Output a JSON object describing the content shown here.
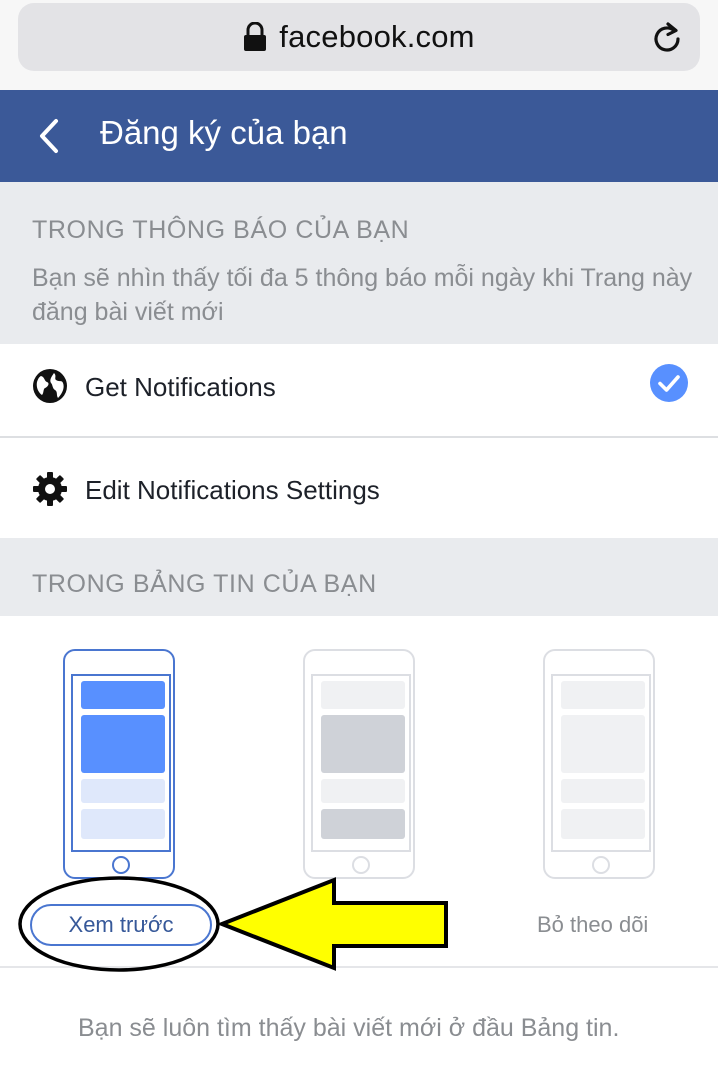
{
  "browser": {
    "url": "facebook.com",
    "lock_icon": "lock-icon",
    "reload_icon": "reload-icon"
  },
  "header": {
    "title": "Đăng ký của bạn",
    "back_icon": "chevron-left-icon",
    "background": "#3b5998"
  },
  "notifications_section": {
    "title": "TRONG THÔNG BÁO CỦA BẠN",
    "description": "Bạn sẽ nhìn thấy tối đa 5 thông báo mỗi ngày khi Trang này đăng bài viết mới",
    "items": [
      {
        "label": "Get Notifications",
        "icon": "globe-icon",
        "checked": true
      },
      {
        "label": "Edit Notifications Settings",
        "icon": "gear-icon"
      }
    ]
  },
  "newsfeed_section": {
    "title": "TRONG BẢNG TIN CỦA BẠN",
    "options": [
      {
        "label": "Xem trước",
        "selected": true
      },
      {
        "label": "",
        "selected": false
      },
      {
        "label": "Bỏ theo dõi",
        "selected": false
      }
    ],
    "footer": "Bạn sẽ luôn tìm thấy bài viết mới ở đầu Bảng tin."
  },
  "colors": {
    "accent": "#4a76d0",
    "check": "#5890ff",
    "arrow": "#ffff00"
  }
}
